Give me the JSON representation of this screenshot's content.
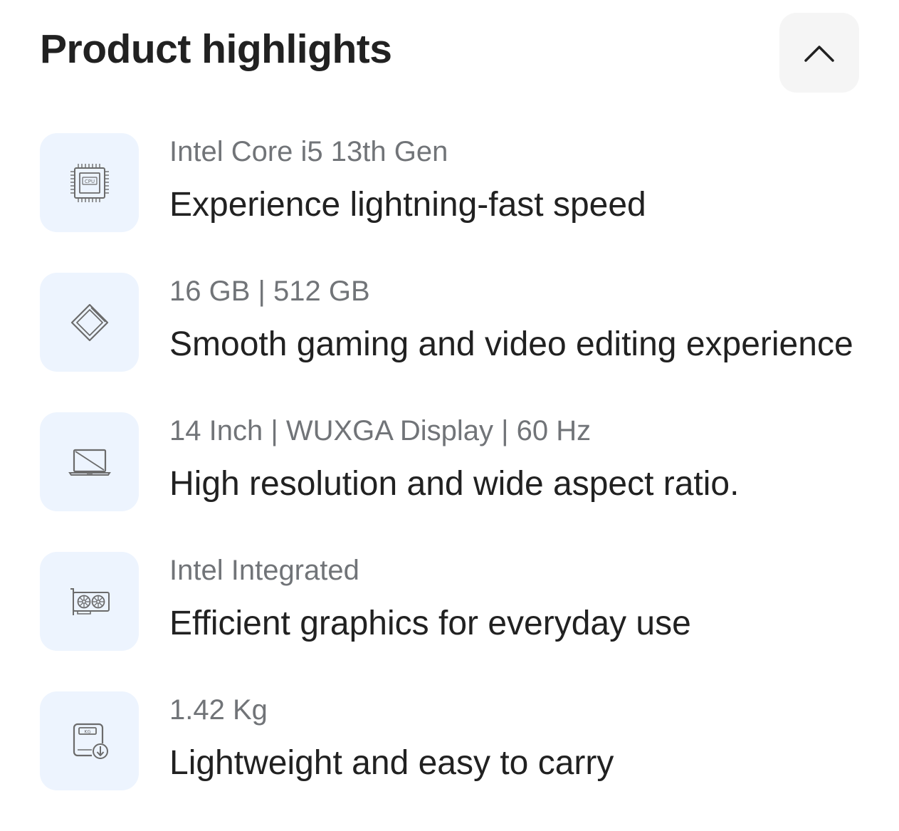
{
  "header": {
    "title": "Product highlights",
    "collapse_icon": "chevron-up-icon"
  },
  "highlights": [
    {
      "icon": "cpu-icon",
      "spec": "Intel Core i5 13th Gen",
      "description": "Experience lightning-fast speed"
    },
    {
      "icon": "ram-storage-icon",
      "spec": "16 GB | 512 GB",
      "description": "Smooth gaming and video editing experience"
    },
    {
      "icon": "laptop-display-icon",
      "spec": "14 Inch | WUXGA Display | 60 Hz",
      "description": "High resolution and wide aspect ratio."
    },
    {
      "icon": "graphics-card-icon",
      "spec": "Intel Integrated",
      "description": "Efficient graphics for everyday use"
    },
    {
      "icon": "weight-scale-icon",
      "spec": "1.42 Kg",
      "description": "Lightweight and easy to carry"
    }
  ],
  "colors": {
    "icon_background": "#edf4fe",
    "button_background": "#f5f5f5",
    "title_text": "#212121",
    "spec_text": "#717478"
  }
}
